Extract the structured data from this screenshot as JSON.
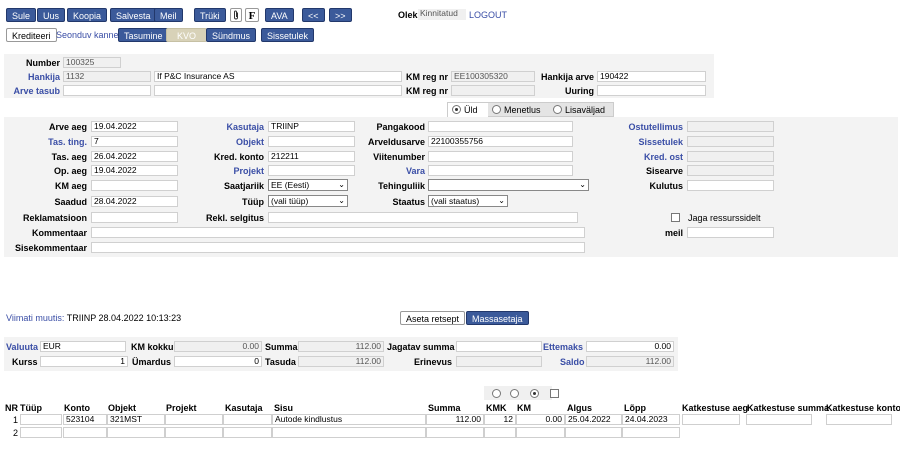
{
  "toolbar": {
    "sule": "Sule",
    "uus": "Uus",
    "koopia": "Koopia",
    "salvesta": "Salvesta",
    "meil": "Meil",
    "tryki": "Trüki",
    "attach_icon": "paperclip-icon",
    "f": "F",
    "ava": "AVA",
    "prev": "<<",
    "next": ">>",
    "olek_label": "Olek",
    "olek_value": "Kinnitatud",
    "logout": "LOGOUT"
  },
  "subtoolbar": {
    "krediteeri": "Krediteeri",
    "seonduv": "Seonduv kanne",
    "tasumine": "Tasumine",
    "kvo": "KVO",
    "syndmus": "Sündmus",
    "sissetulek": "Sissetulek"
  },
  "header": {
    "number_label": "Number",
    "number": "100325",
    "hankija_label": "Hankija",
    "hankija_code": "1132",
    "hankija_name": "If P&C Insurance AS",
    "kmreg_label": "KM reg nr",
    "kmreg": "EE100305320",
    "hankija_arve_label": "Hankija arve",
    "hankija_arve": "190422",
    "arve_tasub_label": "Arve tasub",
    "kmreg2_label": "KM reg nr",
    "uuring_label": "Uuring"
  },
  "tabs": [
    {
      "label": "Üld",
      "selected": true
    },
    {
      "label": "Menetlus",
      "selected": false
    },
    {
      "label": "Lisaväljad",
      "selected": false
    }
  ],
  "form": {
    "arve_aeg_label": "Arve aeg",
    "arve_aeg": "19.04.2022",
    "tas_ting_label": "Tas. ting.",
    "tas_ting": "7",
    "tas_aeg_label": "Tas. aeg",
    "tas_aeg": "26.04.2022",
    "op_aeg_label": "Op. aeg",
    "op_aeg": "19.04.2022",
    "km_aeg_label": "KM aeg",
    "saadud_label": "Saadud",
    "saadud": "28.04.2022",
    "reklamatsioon_label": "Reklamatsioon",
    "kommentaar_label": "Kommentaar",
    "sisekommentaar_label": "Sisekommentaar",
    "kasutaja_label": "Kasutaja",
    "kasutaja": "TRIINP",
    "objekt_label": "Objekt",
    "kred_konto_label": "Kred. konto",
    "kred_konto": "212211",
    "projekt_label": "Projekt",
    "saatjariik_label": "Saatjariik",
    "saatjariik": "EE (Eesti)",
    "tyyp_label": "Tüüp",
    "tyyp": "(vali tüüp)",
    "rekl_selgitus_label": "Rekl. selgitus",
    "pangakood_label": "Pangakood",
    "arveldusarve_label": "Arveldusarve",
    "arveldusarve": "22100355756",
    "viitenumber_label": "Viitenumber",
    "vara_label": "Vara",
    "tehingulik_label": "Tehinguliik",
    "staatus_label": "Staatus",
    "staatus": "(vali staatus)",
    "ostutellimus_label": "Ostutellimus",
    "sissetulek_label": "Sissetulek",
    "kred_ost_label": "Kred. ost",
    "sisearve_label": "Sisearve",
    "kulutus_label": "Kulutus",
    "jaga_label": "Jaga ressurssidelt",
    "meil_label": "meil"
  },
  "status": {
    "viimati": "Viimati muutis:",
    "viimati_value": "TRIINP 28.04.2022 10:13:23",
    "aseta_retsept": "Aseta retsept",
    "massasetaja": "Massasetaja"
  },
  "totals": {
    "valuuta_label": "Valuuta",
    "valuuta": "EUR",
    "km_kokku_label": "KM kokku",
    "km_kokku": "0.00",
    "summa_label": "Summa",
    "summa": "112.00",
    "jagatav_label": "Jagatav summa",
    "ettemaks_label": "Ettemaks",
    "ettemaks": "0.00",
    "kurss_label": "Kurss",
    "kurss": "1",
    "ymardus_label": "Ümardus",
    "ymardus": "0",
    "tasuda_label": "Tasuda",
    "tasuda": "112.00",
    "erinevus_label": "Erinevus",
    "saldo_label": "Saldo",
    "saldo": "112.00"
  },
  "grid": {
    "headers": [
      "NR",
      "Tüüp",
      "Konto",
      "Objekt",
      "Projekt",
      "Kasutaja",
      "Sisu",
      "Summa",
      "KMK",
      "KM",
      "Algus",
      "Lõpp",
      "Katkestuse aeg",
      "Katkestuse summa",
      "Katkestuse konto"
    ],
    "rows": [
      {
        "nr": "1",
        "tyyp": "",
        "konto": "523104",
        "objekt": "321MST",
        "projekt": "",
        "kasutaja": "",
        "sisu": "Autode kindlustus",
        "summa": "112.00",
        "kmk": "12",
        "km": "0.00",
        "algus": "25.04.2022",
        "lopp": "24.04.2023"
      },
      {
        "nr": "2",
        "tyyp": "",
        "konto": "",
        "objekt": "",
        "projekt": "",
        "kasutaja": "",
        "sisu": "",
        "summa": "",
        "kmk": "",
        "km": "",
        "algus": "",
        "lopp": ""
      }
    ]
  },
  "colors": {
    "button": "#3b5a9a",
    "link": "#3a4ea6",
    "panel": "#f3f3f3"
  }
}
